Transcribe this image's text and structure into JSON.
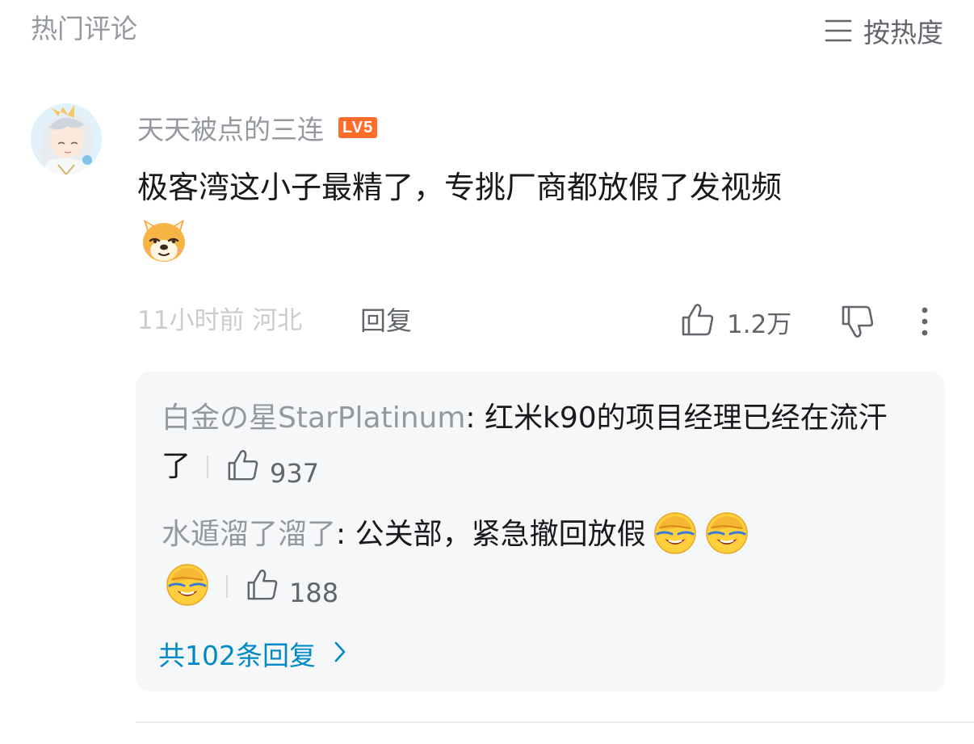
{
  "header": {
    "title": "热门评论",
    "sort_label": "按热度"
  },
  "comment": {
    "username": "天天被点的三连",
    "level": "LV5",
    "text": "极客湾这小子最精了，专挑厂商都放假了发视频",
    "emoji": "doge",
    "meta": "11小时前 河北",
    "reply_label": "回复",
    "like_count": "1.2万"
  },
  "replies": [
    {
      "user": "白金の星StarPlatinum",
      "separator": ": ",
      "text": "红米k90的项目经理已经在流汗了",
      "like_count": "937"
    },
    {
      "user": "水遁溜了溜了",
      "separator": ": ",
      "text": "公关部，紧急撤回放假",
      "emojis": [
        "facepalm-laugh",
        "facepalm-laugh",
        "facepalm-laugh"
      ],
      "like_count": "188"
    }
  ],
  "total_replies": "共102条回复",
  "icons": {
    "sort": "menu-lines-icon",
    "like": "thumbs-up-icon",
    "dislike": "thumbs-down-icon",
    "more": "vertical-dots-icon",
    "chevron": "chevron-right-icon"
  },
  "colors": {
    "level_badge": "#ff6d2b",
    "link": "#008ac5",
    "muted": "#9499a0",
    "reply_bg": "#f6f7f8"
  }
}
